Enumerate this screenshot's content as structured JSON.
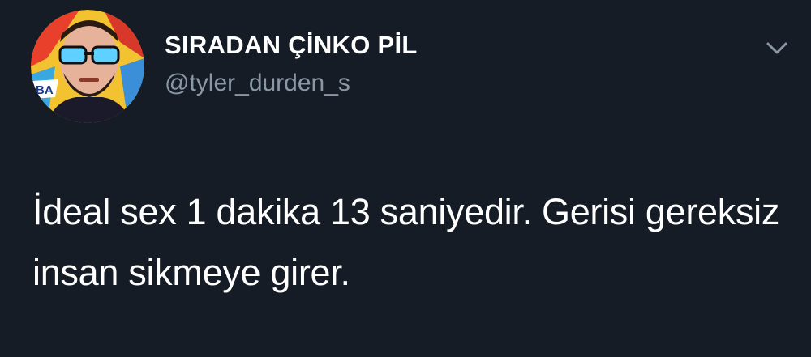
{
  "tweet": {
    "display_name": "SIRADAN ÇİNKO PİL",
    "handle": "@tyler_durden_s",
    "text": "İdeal sex 1 dakika 13 saniyedir. Gerisi gereksiz insan sikmeye girer.",
    "avatar": {
      "badge_text": "BA"
    }
  },
  "icons": {
    "menu": "chevron-down-icon"
  },
  "colors": {
    "background": "#151c25",
    "name": "#ffffff",
    "handle": "#8a98a6",
    "text": "#ffffff",
    "chevron": "#8a98a6"
  }
}
